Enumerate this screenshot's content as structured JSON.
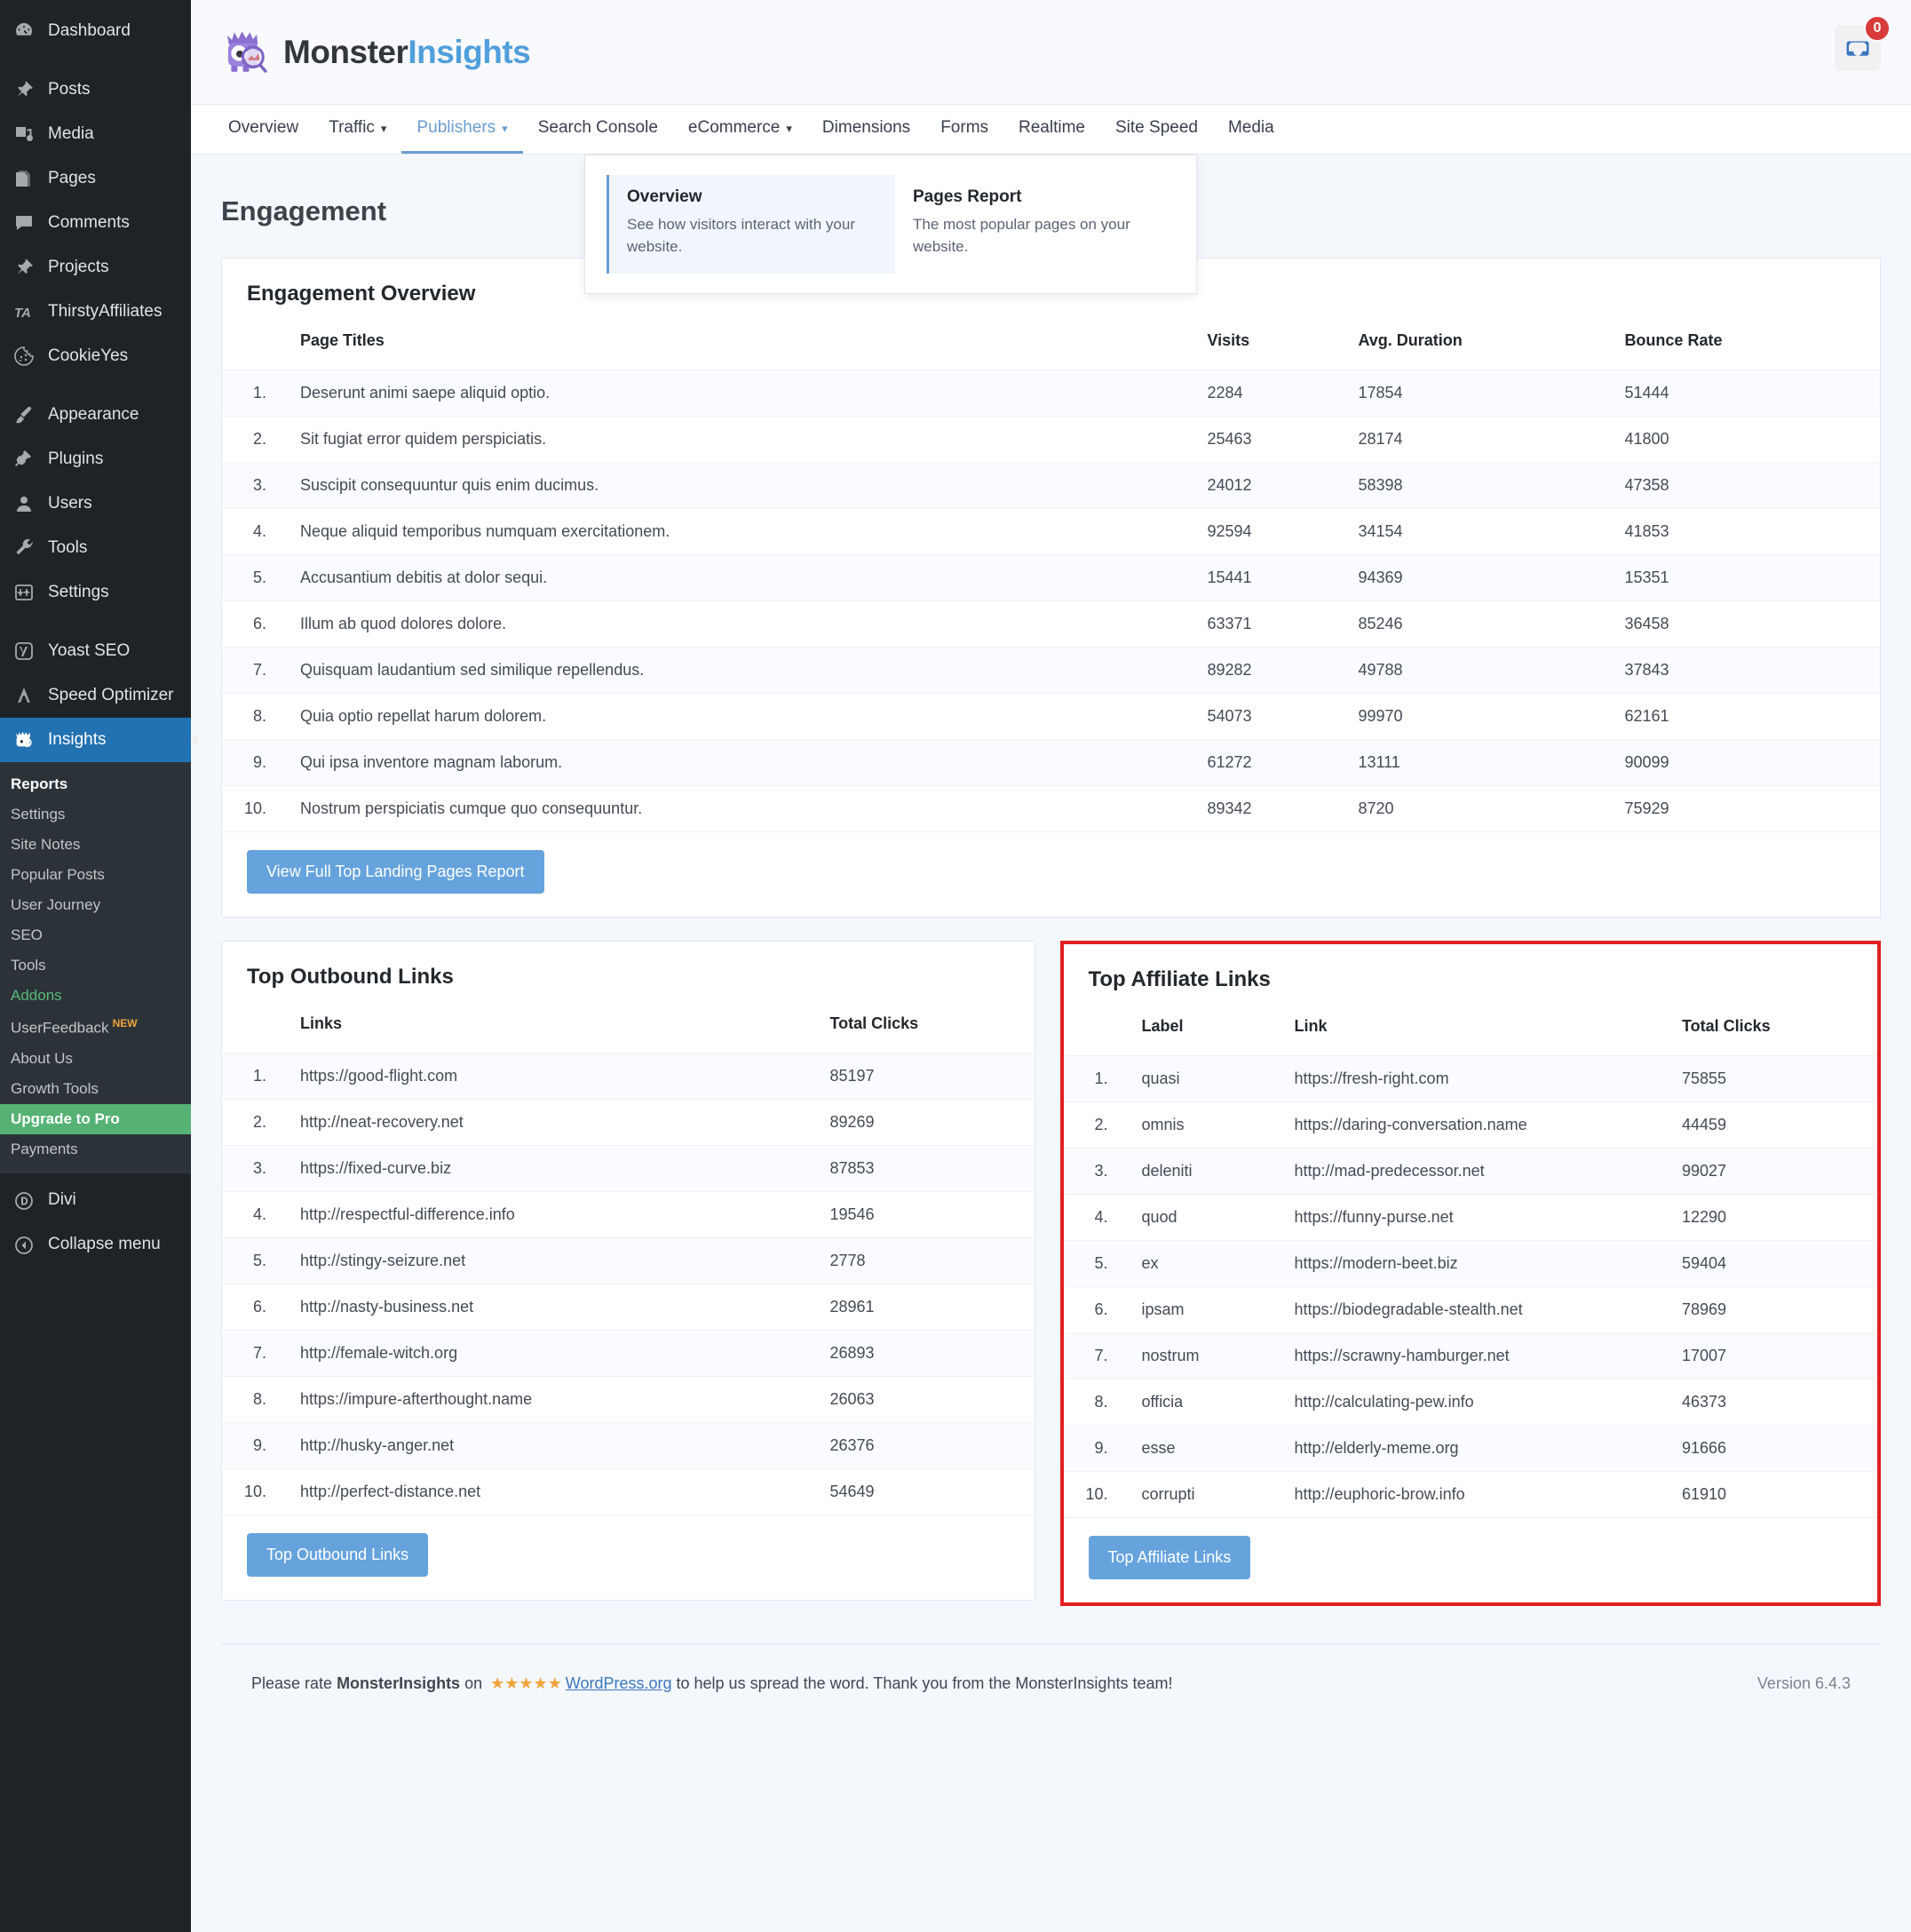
{
  "wp_sidebar": {
    "items": [
      {
        "label": "Dashboard",
        "icon": "dashboard-icon"
      },
      {
        "label": "Posts",
        "icon": "pin-icon"
      },
      {
        "label": "Media",
        "icon": "media-icon"
      },
      {
        "label": "Pages",
        "icon": "pages-icon"
      },
      {
        "label": "Comments",
        "icon": "comment-icon"
      },
      {
        "label": "Projects",
        "icon": "pin-icon"
      },
      {
        "label": "ThirstyAffiliates",
        "icon": "ta-icon"
      },
      {
        "label": "CookieYes",
        "icon": "cookie-icon"
      },
      {
        "label": "Appearance",
        "icon": "brush-icon"
      },
      {
        "label": "Plugins",
        "icon": "plug-icon"
      },
      {
        "label": "Users",
        "icon": "user-icon"
      },
      {
        "label": "Tools",
        "icon": "wrench-icon"
      },
      {
        "label": "Settings",
        "icon": "sliders-icon"
      },
      {
        "label": "Yoast SEO",
        "icon": "yoast-icon"
      },
      {
        "label": "Speed Optimizer",
        "icon": "speed-icon"
      },
      {
        "label": "Insights",
        "icon": "monster-icon"
      }
    ],
    "insights_submenu": [
      {
        "label": "Reports",
        "state": "current"
      },
      {
        "label": "Settings",
        "state": "normal"
      },
      {
        "label": "Site Notes",
        "state": "normal"
      },
      {
        "label": "Popular Posts",
        "state": "normal"
      },
      {
        "label": "User Journey",
        "state": "normal"
      },
      {
        "label": "SEO",
        "state": "normal"
      },
      {
        "label": "Tools",
        "state": "normal"
      },
      {
        "label": "Addons",
        "state": "green"
      },
      {
        "label": "UserFeedback",
        "state": "normal",
        "badge": "NEW"
      },
      {
        "label": "About Us",
        "state": "normal"
      },
      {
        "label": "Growth Tools",
        "state": "normal"
      },
      {
        "label": "Upgrade to Pro",
        "state": "upgrade"
      },
      {
        "label": "Payments",
        "state": "normal"
      }
    ],
    "bottom_items": [
      {
        "label": "Divi",
        "icon": "divi-icon"
      },
      {
        "label": "Collapse menu",
        "icon": "collapse-icon"
      }
    ]
  },
  "header": {
    "brand_first": "Monster",
    "brand_second": "Insights",
    "notification_count": "0",
    "notification_icon": "inbox-icon"
  },
  "nav": {
    "tabs": [
      {
        "label": "Overview",
        "caret": false,
        "active": false
      },
      {
        "label": "Traffic",
        "caret": true,
        "active": false
      },
      {
        "label": "Publishers",
        "caret": true,
        "active": true
      },
      {
        "label": "Search Console",
        "caret": false,
        "active": false
      },
      {
        "label": "eCommerce",
        "caret": true,
        "active": false
      },
      {
        "label": "Dimensions",
        "caret": false,
        "active": false
      },
      {
        "label": "Forms",
        "caret": false,
        "active": false
      },
      {
        "label": "Realtime",
        "caret": false,
        "active": false
      },
      {
        "label": "Site Speed",
        "caret": false,
        "active": false
      },
      {
        "label": "Media",
        "caret": false,
        "active": false
      }
    ],
    "dropdown": [
      {
        "title": "Overview",
        "desc": "See how visitors interact with your website.",
        "selected": true
      },
      {
        "title": "Pages Report",
        "desc": "The most popular pages on your website.",
        "selected": false
      }
    ]
  },
  "page": {
    "title": "Engagement"
  },
  "engagement": {
    "card_title": "Engagement Overview",
    "columns": [
      "Page Titles",
      "Visits",
      "Avg. Duration",
      "Bounce Rate"
    ],
    "rows": [
      {
        "n": "1.",
        "title": "Deserunt animi saepe aliquid optio.",
        "visits": "2284",
        "duration": "17854",
        "bounce": "51444"
      },
      {
        "n": "2.",
        "title": "Sit fugiat error quidem perspiciatis.",
        "visits": "25463",
        "duration": "28174",
        "bounce": "41800"
      },
      {
        "n": "3.",
        "title": "Suscipit consequuntur quis enim ducimus.",
        "visits": "24012",
        "duration": "58398",
        "bounce": "47358"
      },
      {
        "n": "4.",
        "title": "Neque aliquid temporibus numquam exercitationem.",
        "visits": "92594",
        "duration": "34154",
        "bounce": "41853"
      },
      {
        "n": "5.",
        "title": "Accusantium debitis at dolor sequi.",
        "visits": "15441",
        "duration": "94369",
        "bounce": "15351"
      },
      {
        "n": "6.",
        "title": "Illum ab quod dolores dolore.",
        "visits": "63371",
        "duration": "85246",
        "bounce": "36458"
      },
      {
        "n": "7.",
        "title": "Quisquam laudantium sed similique repellendus.",
        "visits": "89282",
        "duration": "49788",
        "bounce": "37843"
      },
      {
        "n": "8.",
        "title": "Quia optio repellat harum dolorem.",
        "visits": "54073",
        "duration": "99970",
        "bounce": "62161"
      },
      {
        "n": "9.",
        "title": "Qui ipsa inventore magnam laborum.",
        "visits": "61272",
        "duration": "13111",
        "bounce": "90099"
      },
      {
        "n": "10.",
        "title": "Nostrum perspiciatis cumque quo consequuntur.",
        "visits": "89342",
        "duration": "8720",
        "bounce": "75929"
      }
    ],
    "button": "View Full Top Landing Pages Report"
  },
  "outbound": {
    "card_title": "Top Outbound Links",
    "columns": [
      "Links",
      "Total Clicks"
    ],
    "rows": [
      {
        "n": "1.",
        "link": "https://good-flight.com",
        "clicks": "85197"
      },
      {
        "n": "2.",
        "link": "http://neat-recovery.net",
        "clicks": "89269"
      },
      {
        "n": "3.",
        "link": "https://fixed-curve.biz",
        "clicks": "87853"
      },
      {
        "n": "4.",
        "link": "http://respectful-difference.info",
        "clicks": "19546"
      },
      {
        "n": "5.",
        "link": "http://stingy-seizure.net",
        "clicks": "2778"
      },
      {
        "n": "6.",
        "link": "http://nasty-business.net",
        "clicks": "28961"
      },
      {
        "n": "7.",
        "link": "http://female-witch.org",
        "clicks": "26893"
      },
      {
        "n": "8.",
        "link": "https://impure-afterthought.name",
        "clicks": "26063"
      },
      {
        "n": "9.",
        "link": "http://husky-anger.net",
        "clicks": "26376"
      },
      {
        "n": "10.",
        "link": "http://perfect-distance.net",
        "clicks": "54649"
      }
    ],
    "button": "Top Outbound Links"
  },
  "affiliate": {
    "card_title": "Top Affiliate Links",
    "columns": [
      "Label",
      "Link",
      "Total Clicks"
    ],
    "rows": [
      {
        "n": "1.",
        "label": "quasi",
        "link": "https://fresh-right.com",
        "clicks": "75855"
      },
      {
        "n": "2.",
        "label": "omnis",
        "link": "https://daring-conversation.name",
        "clicks": "44459"
      },
      {
        "n": "3.",
        "label": "deleniti",
        "link": "http://mad-predecessor.net",
        "clicks": "99027"
      },
      {
        "n": "4.",
        "label": "quod",
        "link": "https://funny-purse.net",
        "clicks": "12290"
      },
      {
        "n": "5.",
        "label": "ex",
        "link": "https://modern-beet.biz",
        "clicks": "59404"
      },
      {
        "n": "6.",
        "label": "ipsam",
        "link": "https://biodegradable-stealth.net",
        "clicks": "78969"
      },
      {
        "n": "7.",
        "label": "nostrum",
        "link": "https://scrawny-hamburger.net",
        "clicks": "17007"
      },
      {
        "n": "8.",
        "label": "officia",
        "link": "http://calculating-pew.info",
        "clicks": "46373"
      },
      {
        "n": "9.",
        "label": "esse",
        "link": "http://elderly-meme.org",
        "clicks": "91666"
      },
      {
        "n": "10.",
        "label": "corrupti",
        "link": "http://euphoric-brow.info",
        "clicks": "61910"
      }
    ],
    "button": "Top Affiliate Links",
    "highlight_color": "#e02020"
  },
  "footer": {
    "text_before": "Please rate ",
    "brand": "MonsterInsights",
    "text_on": " on ",
    "stars": "★★★★★",
    "link": "WordPress.org",
    "text_after": " to help us spread the word. Thank you from the MonsterInsights team!",
    "version": "Version 6.4.3"
  },
  "colors": {
    "accent": "#66a3dd",
    "brand_blue": "#509fdc",
    "wp_dark": "#1d2327",
    "upgrade_green": "#56b274",
    "highlight_red": "#e02020"
  }
}
